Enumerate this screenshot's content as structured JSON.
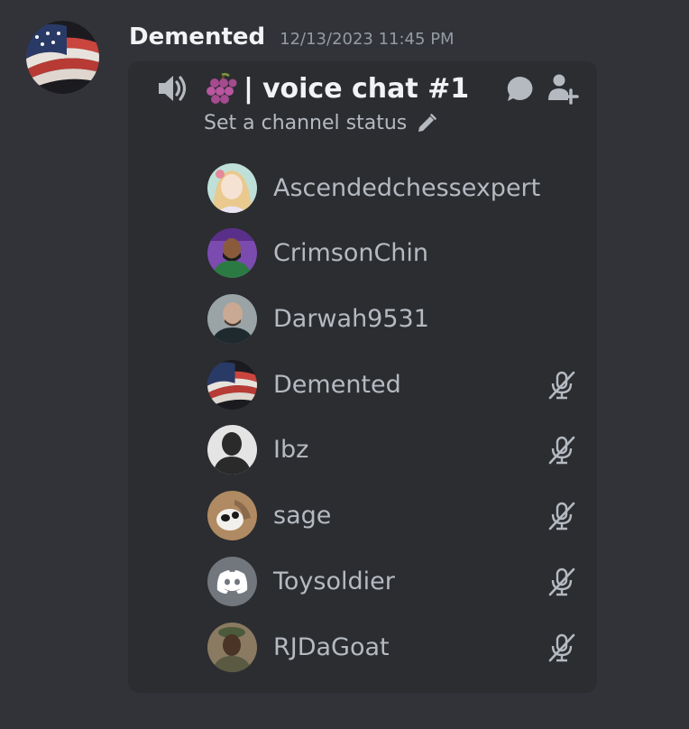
{
  "message": {
    "author": "Demented",
    "timestamp": "12/13/2023 11:45 PM"
  },
  "voice_channel": {
    "channel_emoji": "🍇",
    "separator": "|",
    "name": "voice chat #1",
    "status_placeholder": "Set a channel status",
    "icons": {
      "speaker": "speaker-icon",
      "chat": "chat-bubble-icon",
      "invite": "add-user-icon",
      "status_edit": "pencil-icon",
      "muted": "muted-mic-icon"
    },
    "members": [
      {
        "name": "Ascendedchessexpert",
        "muted": false
      },
      {
        "name": "CrimsonChin",
        "muted": false
      },
      {
        "name": "Darwah9531",
        "muted": false
      },
      {
        "name": "Demented",
        "muted": true
      },
      {
        "name": "Ibz",
        "muted": true
      },
      {
        "name": "sage",
        "muted": true
      },
      {
        "name": "Toysoldier",
        "muted": true
      },
      {
        "name": "RJDaGoat",
        "muted": true
      }
    ]
  }
}
